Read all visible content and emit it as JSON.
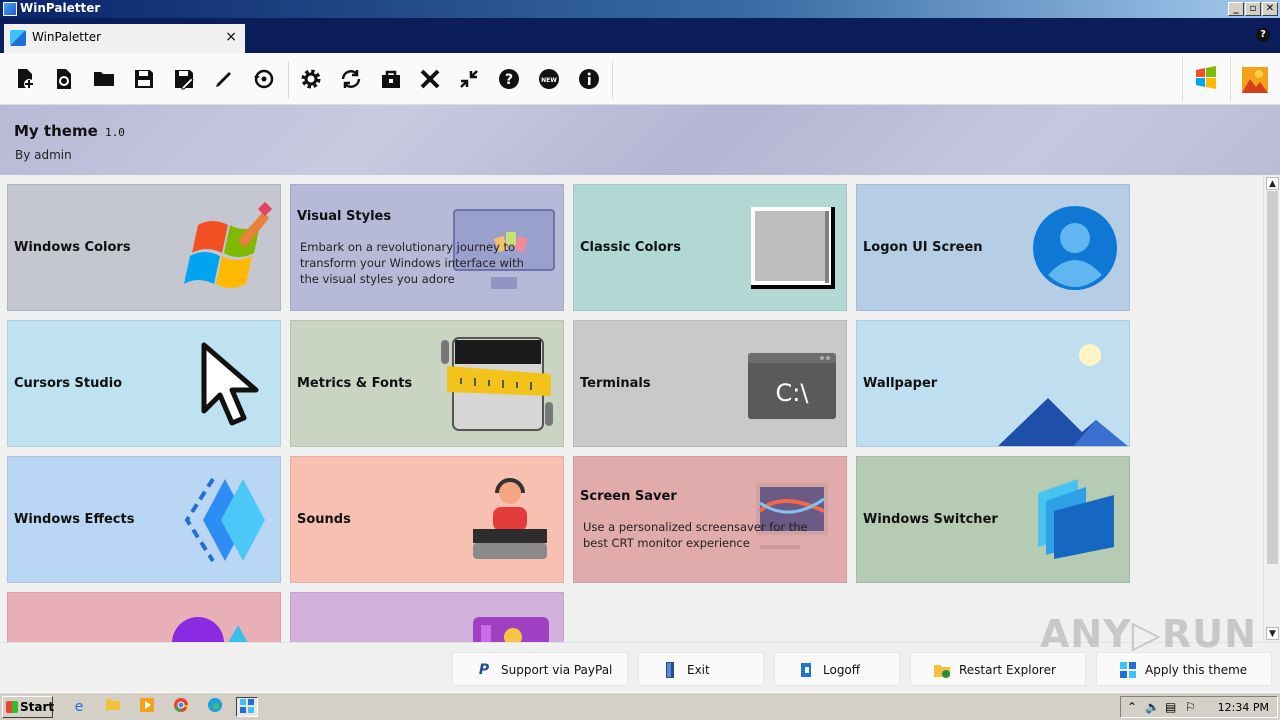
{
  "window": {
    "title": "WinPaletter",
    "min": "_",
    "max": "▫",
    "close": "✕"
  },
  "tab": {
    "label": "WinPaletter",
    "close": "×"
  },
  "help_badge": "?",
  "toolbar": {
    "icons": [
      "new-theme-icon",
      "reload-icon",
      "open-folder-icon",
      "save-icon",
      "save-as-icon",
      "edit-icon",
      "restore-icon",
      "settings-icon",
      "refresh-icon",
      "store-icon",
      "tools-icon",
      "collapse-icon",
      "help-icon",
      "whats-new-icon",
      "info-icon"
    ],
    "glyphs": [
      "🗋",
      "⟲",
      "📁",
      "💾",
      "🖫",
      "✎",
      "↺",
      "⚙",
      "⟳",
      "🔒",
      "✂",
      "⤡",
      "?",
      "New",
      "i"
    ]
  },
  "theme": {
    "name": "My theme",
    "version": "1.0",
    "author": "By admin"
  },
  "cards": [
    {
      "title": "Windows Colors",
      "desc": "",
      "bg": "#c4c6d0"
    },
    {
      "title": "Visual Styles",
      "desc": "Embark on a revolutionary journey to transform your Windows interface with the visual styles you adore",
      "bg": "#b7b9d8"
    },
    {
      "title": "Classic Colors",
      "desc": "",
      "bg": "#b2d8d6"
    },
    {
      "title": "Logon UI Screen",
      "desc": "",
      "bg": "#b6cde6"
    },
    {
      "title": "Cursors Studio",
      "desc": "",
      "bg": "#bfe2f0"
    },
    {
      "title": "Metrics & Fonts",
      "desc": "",
      "bg": "#c9d4c2"
    },
    {
      "title": "Terminals",
      "desc": "",
      "bg": "#c9c9c9"
    },
    {
      "title": "Wallpaper",
      "desc": "",
      "bg": "#bfdff0"
    },
    {
      "title": "Windows Effects",
      "desc": "",
      "bg": "#bad6f5"
    },
    {
      "title": "Sounds",
      "desc": "",
      "bg": "#f7c0b0"
    },
    {
      "title": "Screen Saver",
      "desc": "Use a personalized screensaver for the best CRT monitor experience",
      "bg": "#e1aaab"
    },
    {
      "title": "Windows Switcher",
      "desc": "",
      "bg": "#b5cbb3"
    },
    {
      "title": "",
      "desc": "",
      "bg": "#e8b0b6"
    },
    {
      "title": "",
      "desc": "",
      "bg": "#d2b2dc"
    }
  ],
  "bottom": {
    "paypal": "Support via PayPal",
    "exit": "Exit",
    "logoff": "Logoff",
    "restart": "Restart Explorer",
    "apply": "Apply this theme"
  },
  "watermark": "ANY▷RUN",
  "taskbar": {
    "start": "Start",
    "clock": "12:34 PM"
  },
  "colors": {
    "accent": "#0b1e5b",
    "paypal": "#1e4fa0",
    "exit": "#2b4a8a",
    "logoff": "#1f76d2"
  }
}
